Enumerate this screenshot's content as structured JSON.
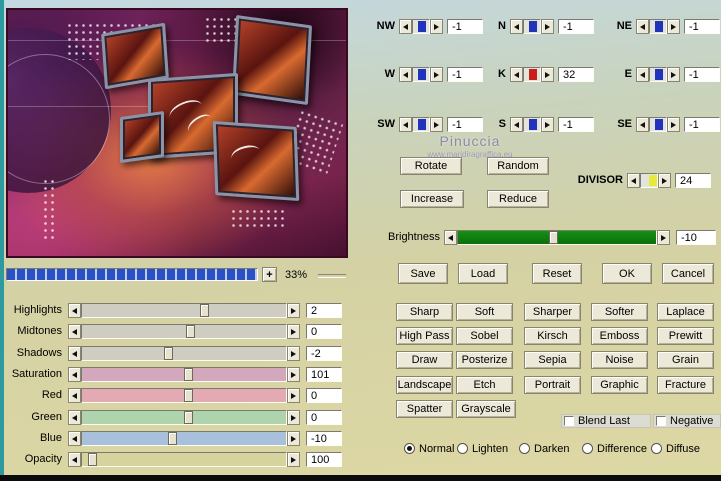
{
  "colors": {
    "background_top": "#c3d8e2",
    "background_bottom": "#ddd8a4",
    "button_face": "#ece9d8",
    "matrix_thumb_blue": "#2133bb",
    "k_thumb_red": "#cc1d1d",
    "divisor_thumb_yellow": "#e9e93c",
    "brightness_track_green": "#0c6e0c",
    "progress_bar_blue": "#2a50c8",
    "edge_teal": "#2d9aa0"
  },
  "preview": {
    "zoom_plus": "+",
    "zoom_value": "33%"
  },
  "matrix": {
    "cells": [
      {
        "label": "NW",
        "value": "-1"
      },
      {
        "label": "N",
        "value": "-1"
      },
      {
        "label": "NE",
        "value": "-1"
      },
      {
        "label": "W",
        "value": "-1"
      },
      {
        "label": "K",
        "value": "32"
      },
      {
        "label": "E",
        "value": "-1"
      },
      {
        "label": "SW",
        "value": "-1"
      },
      {
        "label": "S",
        "value": "-1"
      },
      {
        "label": "SE",
        "value": "-1"
      }
    ],
    "divisor_label": "DIVISOR",
    "divisor_value": "24"
  },
  "watermark": {
    "line1": "Pinuccia",
    "line2": "www.maridiragraffica.eu"
  },
  "action_buttons": {
    "rotate": "Rotate",
    "random": "Random",
    "increase": "Increase",
    "reduce": "Reduce"
  },
  "brightness": {
    "label": "Brightness",
    "value": "-10"
  },
  "dialog_buttons": {
    "save": "Save",
    "load": "Load",
    "reset": "Reset",
    "ok": "OK",
    "cancel": "Cancel"
  },
  "sliders": [
    {
      "label": "Highlights",
      "value": "2",
      "track_color": "#cfccc2"
    },
    {
      "label": "Midtones",
      "value": "0",
      "track_color": "#cfccc2"
    },
    {
      "label": "Shadows",
      "value": "-2",
      "track_color": "#cfccc2"
    },
    {
      "label": "Saturation",
      "value": "101",
      "track_color": "#d4a8bc"
    },
    {
      "label": "Red",
      "value": "0",
      "track_color": "#e4aab4"
    },
    {
      "label": "Green",
      "value": "0",
      "track_color": "#aed4ae"
    },
    {
      "label": "Blue",
      "value": "-10",
      "track_color": "#a8c0dc"
    },
    {
      "label": "Opacity",
      "value": "100",
      "track_color": "#d6d49c"
    }
  ],
  "filters": [
    "Sharp",
    "Soft",
    "Sharper",
    "Softer",
    "Laplace",
    "High Pass",
    "Sobel",
    "Kirsch",
    "Emboss",
    "Prewitt",
    "Draw",
    "Posterize",
    "Sepia",
    "Noise",
    "Grain",
    "Landscape",
    "Etch",
    "Portrait",
    "Graphic",
    "Fracture",
    "Spatter",
    "Grayscale"
  ],
  "checkboxes": [
    {
      "label": "Blend Last",
      "checked": false
    },
    {
      "label": "Negative",
      "checked": false
    }
  ],
  "blend_modes": [
    {
      "label": "Normal",
      "selected": true
    },
    {
      "label": "Lighten",
      "selected": false
    },
    {
      "label": "Darken",
      "selected": false
    },
    {
      "label": "Difference",
      "selected": false
    },
    {
      "label": "Diffuse",
      "selected": false
    }
  ]
}
